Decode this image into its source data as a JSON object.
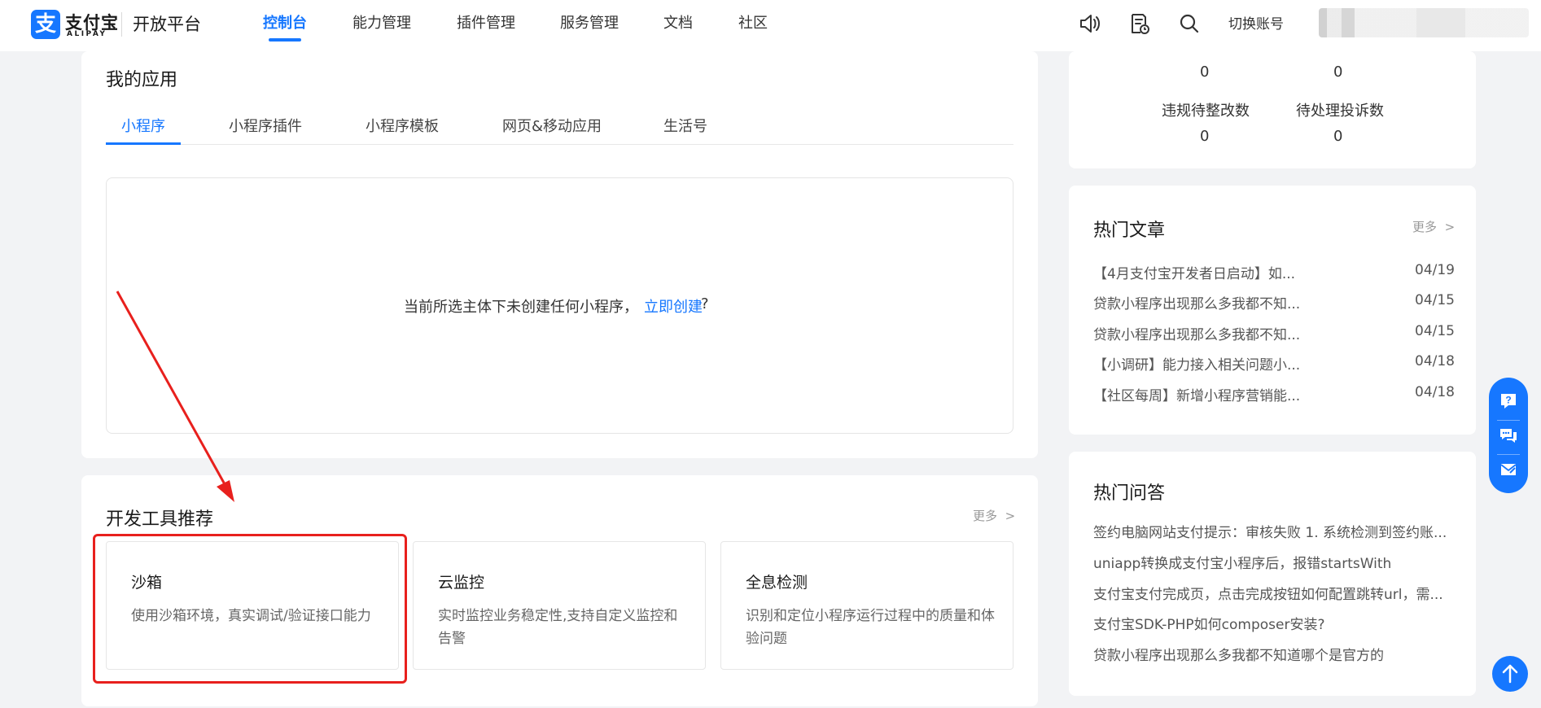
{
  "header": {
    "logo_icon": "支",
    "logo_cn": "支付宝",
    "logo_en": "ALIPAY",
    "platform": "开放平台",
    "nav": [
      {
        "label": "控制台",
        "active": true
      },
      {
        "label": "能力管理"
      },
      {
        "label": "插件管理"
      },
      {
        "label": "服务管理"
      },
      {
        "label": "文档"
      },
      {
        "label": "社区"
      }
    ],
    "icons": [
      "speaker-icon",
      "document-clock-icon",
      "search-icon"
    ],
    "switch_account": "切换账号"
  },
  "my_apps": {
    "title": "我的应用",
    "tabs": [
      "小程序",
      "小程序插件",
      "小程序模板",
      "网页&移动应用",
      "生活号"
    ],
    "active_tab": "小程序",
    "empty_message": "当前所选主体下未创建任何小程序，",
    "create_link": "立即创建",
    "create_suffix": "?"
  },
  "dev_tools": {
    "title": "开发工具推荐",
    "more": "更多",
    "tools": [
      {
        "name": "沙箱",
        "desc": "使用沙箱环境，真实调试/验证接口能力"
      },
      {
        "name": "云监控",
        "desc": "实时监控业务稳定性,支持自定义监控和告警"
      },
      {
        "name": "全息检测",
        "desc": "识别和定位小程序运行过程中的质量和体验问题"
      }
    ]
  },
  "stats": {
    "top_values": [
      "0",
      "0"
    ],
    "labels": [
      "违规待整改数",
      "待处理投诉数"
    ],
    "values": [
      "0",
      "0"
    ]
  },
  "hot_articles": {
    "title": "热门文章",
    "more": "更多",
    "items": [
      {
        "title": "【4月支付宝开发者日启动】如...",
        "date": "04/19"
      },
      {
        "title": "贷款小程序出现那么多我都不知...",
        "date": "04/15"
      },
      {
        "title": "贷款小程序出现那么多我都不知...",
        "date": "04/15"
      },
      {
        "title": "【小调研】能力接入相关问题小...",
        "date": "04/18"
      },
      {
        "title": "【社区每周】新增小程序营销能...",
        "date": "04/18"
      }
    ]
  },
  "hot_qa": {
    "title": "热门问答",
    "items": [
      "签约电脑网站支付提示：审核失败 1. 系统检测到签约账...",
      "uniapp转换成支付宝小程序后，报错startsWith",
      "支付宝支付完成页，点击完成按钮如何配置跳转url，需...",
      "支付宝SDK-PHP如何composer安装?",
      "贷款小程序出现那么多我都不知道哪个是官方的"
    ]
  },
  "colors": {
    "brand": "#1677ff",
    "annotation": "#e8201d"
  }
}
